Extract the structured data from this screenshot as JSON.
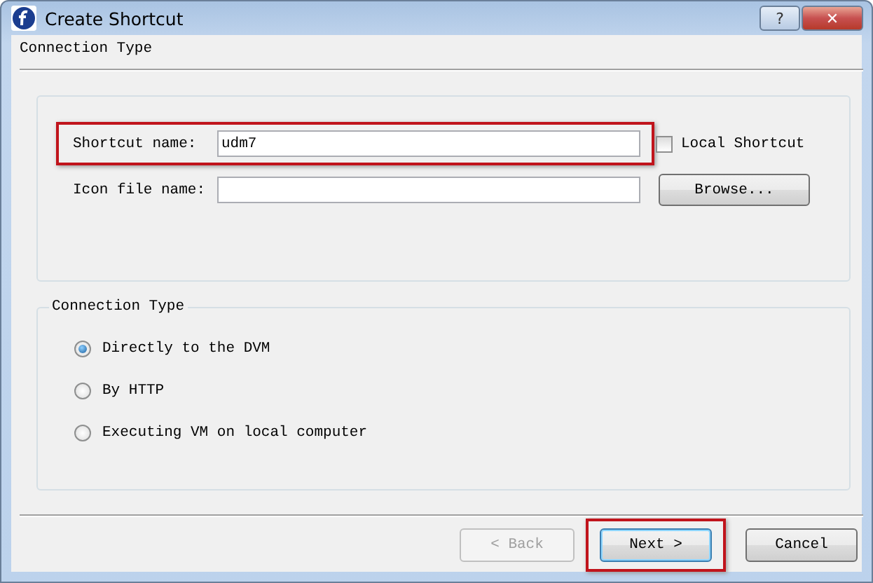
{
  "window": {
    "title": "Create Shortcut",
    "buttons": [
      {
        "kind": "help",
        "label": "?"
      },
      {
        "kind": "close",
        "label": "✕"
      }
    ]
  },
  "page_title": "Connection Type",
  "shortcut_row": {
    "label": "Shortcut name:",
    "value": "udm7",
    "highlighted": true
  },
  "local_shortcut": {
    "label": "Local Shortcut",
    "checked": false
  },
  "icon_row": {
    "label": "Icon file name:"
  },
  "browse_button": "Browse...",
  "connection_group": {
    "title": "Connection Type",
    "options": [
      {
        "label": "Directly to the DVM",
        "selected": true
      },
      {
        "label": "By HTTP",
        "selected": false
      },
      {
        "label": "Executing VM on local computer",
        "selected": false
      }
    ]
  },
  "buttons": [
    {
      "label": "< Back",
      "disabled": true,
      "default": false,
      "highlighted": false
    },
    {
      "label": "Next >",
      "disabled": false,
      "default": true,
      "highlighted": true
    },
    {
      "label": "Cancel",
      "disabled": false,
      "default": false,
      "highlighted": false
    }
  ]
}
